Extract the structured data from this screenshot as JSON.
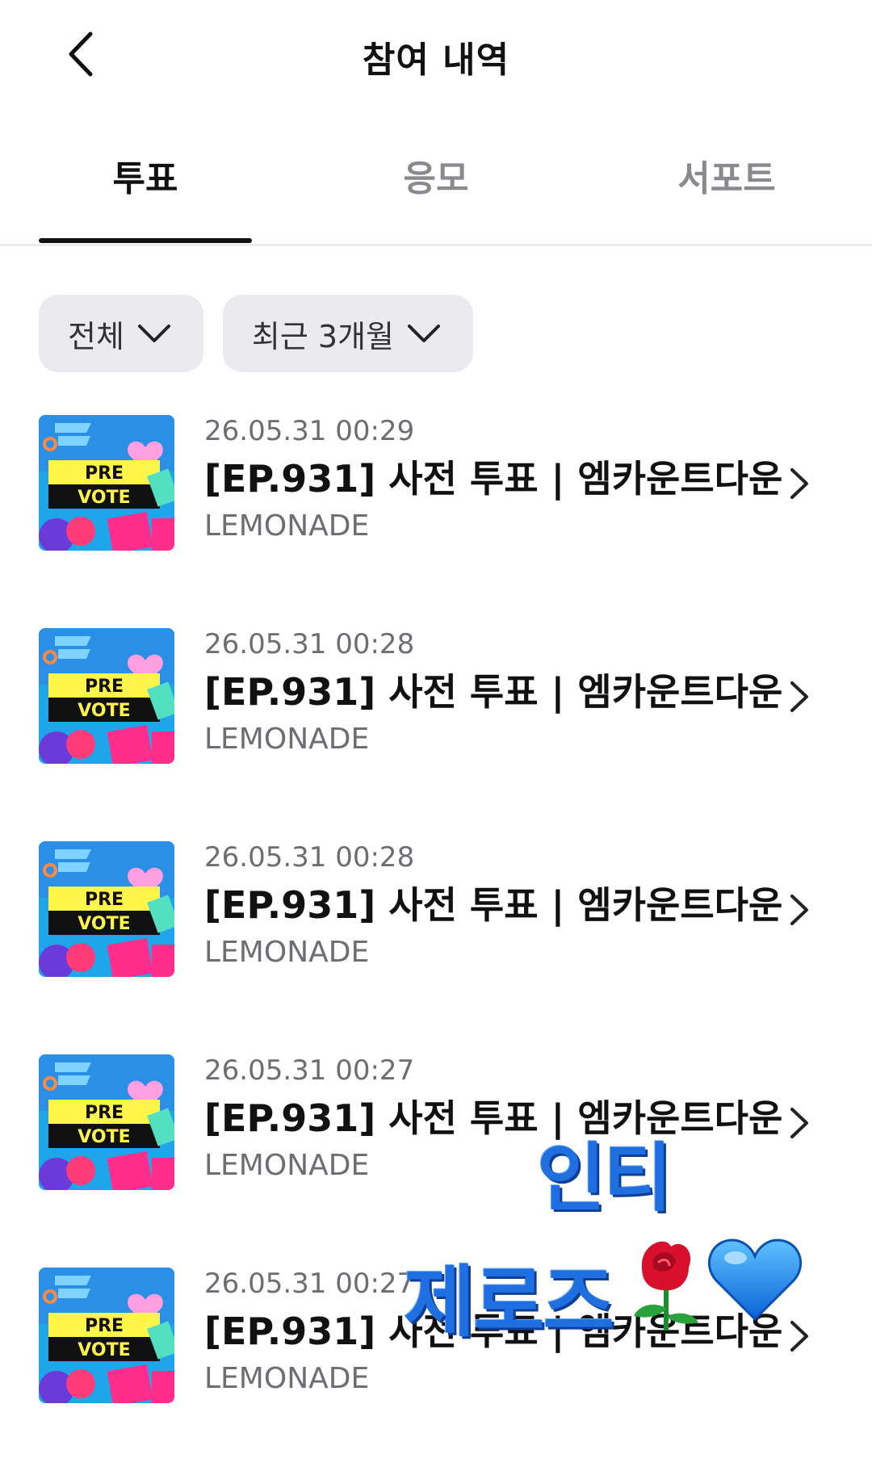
{
  "header": {
    "title": "참여 내역"
  },
  "tabs": [
    {
      "label": "투표",
      "active": true
    },
    {
      "label": "응모",
      "active": false
    },
    {
      "label": "서포트",
      "active": false
    }
  ],
  "filters": [
    {
      "label": "전체"
    },
    {
      "label": "최근 3개월"
    }
  ],
  "thumbnail": {
    "line1": "PRE",
    "line2": "VOTE"
  },
  "items": [
    {
      "date": "26.05.31 00:29",
      "title": "[EP.931] 사전 투표 | 엠카운트다운",
      "brand": "LEMONADE"
    },
    {
      "date": "26.05.31 00:28",
      "title": "[EP.931] 사전 투표 | 엠카운트다운",
      "brand": "LEMONADE"
    },
    {
      "date": "26.05.31 00:28",
      "title": "[EP.931] 사전 투표 | 엠카운트다운",
      "brand": "LEMONADE"
    },
    {
      "date": "26.05.31 00:27",
      "title": "[EP.931] 사전 투표 | 엠카운트다운",
      "brand": "LEMONADE"
    },
    {
      "date": "26.05.31 00:27",
      "title": "[EP.931] 사전 투표 | 엠카운트다운",
      "brand": "LEMONADE"
    }
  ],
  "stickers": {
    "line1": "인티",
    "line2": "제로즈"
  },
  "icons": {
    "back": "chevron-left-icon",
    "dropdown": "chevron-down-icon",
    "row_arrow": "chevron-right-icon",
    "rose": "rose-emoji",
    "heart": "blue-heart-emoji"
  },
  "colors": {
    "active_tab": "#111111",
    "inactive_tab": "#8a8a8e",
    "chip_bg": "#ebebef",
    "sticker_blue": "#1f6fe0"
  }
}
